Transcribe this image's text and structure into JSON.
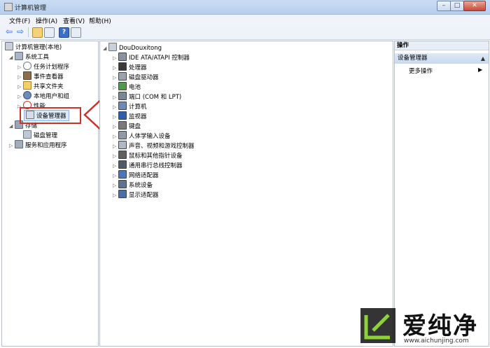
{
  "window": {
    "title": "计算机管理"
  },
  "menu": {
    "items": [
      "文件(F)",
      "操作(A)",
      "查看(V)",
      "帮助(H)"
    ]
  },
  "tree": {
    "root": "计算机管理(本地)",
    "system_tools": "系统工具",
    "task_scheduler": "任务计划程序",
    "event_viewer": "事件查看器",
    "shared_folders": "共享文件夹",
    "local_users": "本地用户和组",
    "performance": "性能",
    "device_manager": "设备管理器",
    "storage": "存储",
    "disk_management": "磁盘管理",
    "services_apps": "服务和应用程序"
  },
  "devices": {
    "computer_name": "DouDouxitong",
    "items": [
      "IDE ATA/ATAPI 控制器",
      "处理器",
      "磁盘驱动器",
      "电池",
      "端口 (COM 和 LPT)",
      "计算机",
      "监视器",
      "键盘",
      "人体学输入设备",
      "声音、视频和游戏控制器",
      "鼠标和其他指针设备",
      "通用串行总线控制器",
      "网络适配器",
      "系统设备",
      "显示适配器"
    ]
  },
  "actions": {
    "header": "操作",
    "section": "设备管理器",
    "more": "更多操作"
  },
  "watermark": {
    "brand": "爱纯净",
    "url": "www.aichunjing.com"
  },
  "colors": {
    "annotation_red": "#c8332b"
  }
}
